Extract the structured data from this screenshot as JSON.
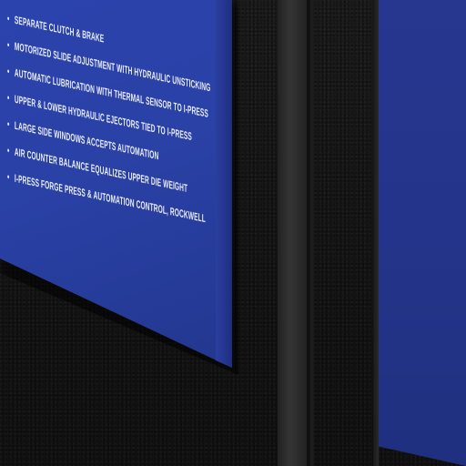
{
  "sign": {
    "items": [
      "SEPARATE CLUTCH & BRAKE",
      "MOTORIZED SLIDE ADJUSTMENT WITH HYDRAULIC UNSTICKING",
      "AUTOMATIC LUBRICATION WITH THERMAL SENSOR TO I-PRESS",
      "UPPER & LOWER HYDRAULIC EJECTORS TIED TO I-PRESS",
      "LARGE SIDE WINDOWS ACCEPTS AUTOMATION",
      "AIR COUNTER BALANCE EQUALIZES UPPER DIE WEIGHT",
      "I-PRESS FORGE PRESS & AUTOMATION CONTROL, ROCKWELL"
    ],
    "color": "#2a41a6",
    "text_color": "#e9ecf7"
  }
}
